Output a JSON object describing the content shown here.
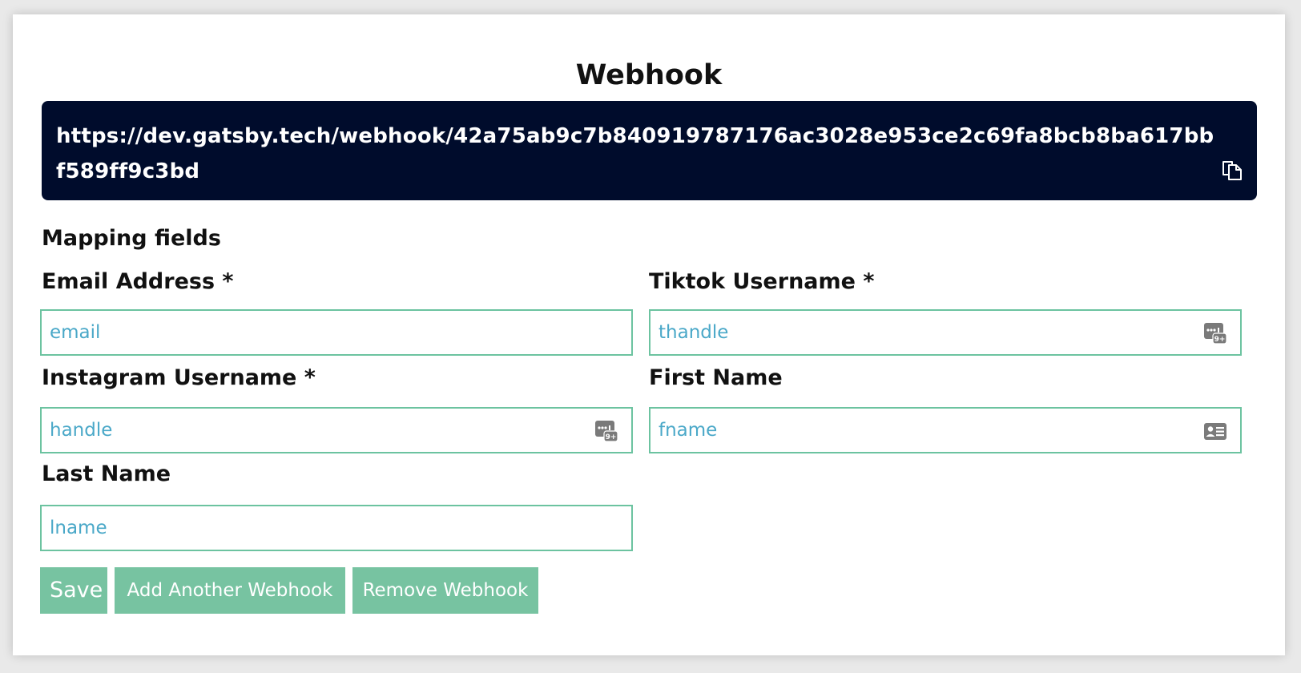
{
  "page": {
    "title": "Webhook",
    "webhook_url": "https://dev.gatsby.tech/webhook/42a75ab9c7b840919787176ac3028e953ce2c69fa8bcb8ba617bbf589ff9c3bd",
    "copy_icon": "copy-icon"
  },
  "mapping": {
    "section_label": "Mapping fields",
    "fields": {
      "email": {
        "label": "Email Address *",
        "placeholder": "email",
        "value": ""
      },
      "tiktok": {
        "label": "Tiktok Username *",
        "placeholder": "thandle",
        "value": "",
        "icon": "password-manager-icon"
      },
      "instagram": {
        "label": "Instagram Username *",
        "placeholder": "handle",
        "value": "",
        "icon": "password-manager-icon"
      },
      "first_name": {
        "label": "First Name",
        "placeholder": "fname",
        "value": "",
        "icon": "contact-card-icon"
      },
      "last_name": {
        "label": "Last Name",
        "placeholder": "lname",
        "value": ""
      }
    }
  },
  "actions": {
    "save_label": "Save",
    "add_label": "Add Another Webhook",
    "remove_label": "Remove Webhook"
  },
  "colors": {
    "url_box_bg": "#000c2c",
    "field_border": "#6cc3a0",
    "placeholder_text": "#4aa8c8",
    "button_bg": "#77c3a1",
    "icon_gray": "#7a7a7a"
  }
}
